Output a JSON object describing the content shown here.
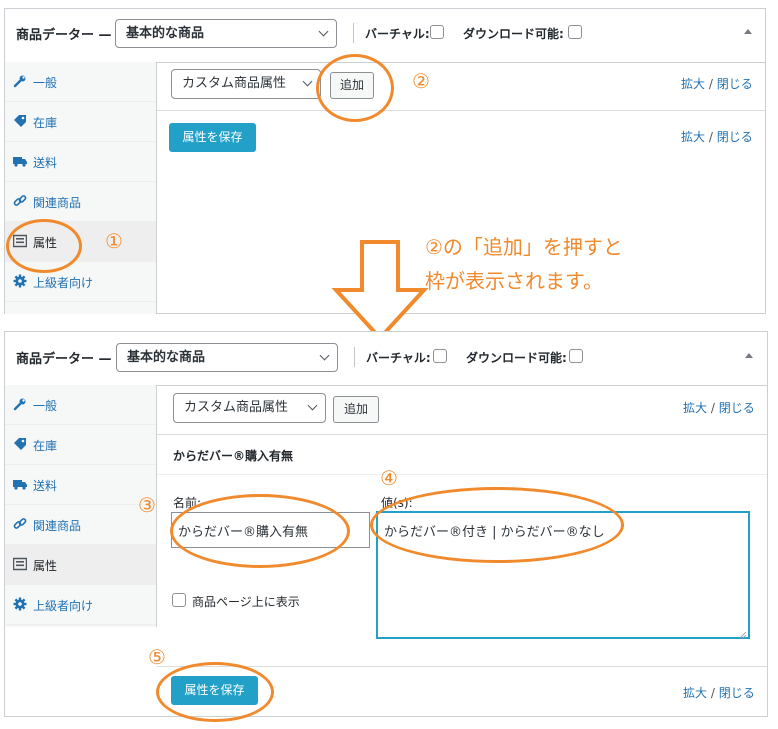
{
  "top": {
    "header": {
      "title": "商品データー —",
      "product_type": "基本的な商品",
      "virtual_label": "バーチャル:",
      "download_label": "ダウンロード可能:"
    },
    "sidebar": [
      {
        "label": "一般",
        "icon": "wrench-icon"
      },
      {
        "label": "在庫",
        "icon": "tag-icon"
      },
      {
        "label": "送料",
        "icon": "truck-icon"
      },
      {
        "label": "関連商品",
        "icon": "link-icon"
      },
      {
        "label": "属性",
        "icon": "list-icon",
        "active": true
      },
      {
        "label": "上級者向け",
        "icon": "gear-icon"
      }
    ],
    "attribute_select": "カスタム商品属性",
    "add_button": "追加",
    "expand_label": "拡大",
    "close_label": "閉じる",
    "save_button": "属性を保存"
  },
  "bottom": {
    "header": {
      "title": "商品データー —",
      "product_type": "基本的な商品",
      "virtual_label": "バーチャル:",
      "download_label": "ダウンロード可能:"
    },
    "sidebar": [
      {
        "label": "一般",
        "icon": "wrench-icon"
      },
      {
        "label": "在庫",
        "icon": "tag-icon"
      },
      {
        "label": "送料",
        "icon": "truck-icon"
      },
      {
        "label": "関連商品",
        "icon": "link-icon"
      },
      {
        "label": "属性",
        "icon": "list-icon",
        "active": true
      },
      {
        "label": "上級者向け",
        "icon": "gear-icon"
      }
    ],
    "attribute_select": "カスタム商品属性",
    "add_button": "追加",
    "expand_label": "拡大",
    "close_label": "閉じる",
    "attribute_heading": "からだバー®購入有無",
    "name_label": "名前:",
    "name_value": "からだバー®購入有無",
    "values_label": "値(s):",
    "values_value": "からだバー®付き | からだバー®なし",
    "visible_checkbox_label": "商品ページ上に表示",
    "save_button": "属性を保存"
  },
  "annotations": {
    "step1": "①",
    "step2": "②",
    "step3": "③",
    "step4": "④",
    "step5": "⑤",
    "note_line1": "②の「追加」を押すと",
    "note_line2": "枠が表示されます。"
  },
  "colors": {
    "accent": "#22a0c8",
    "link": "#2271b1",
    "annotation": "#f08a2c"
  }
}
